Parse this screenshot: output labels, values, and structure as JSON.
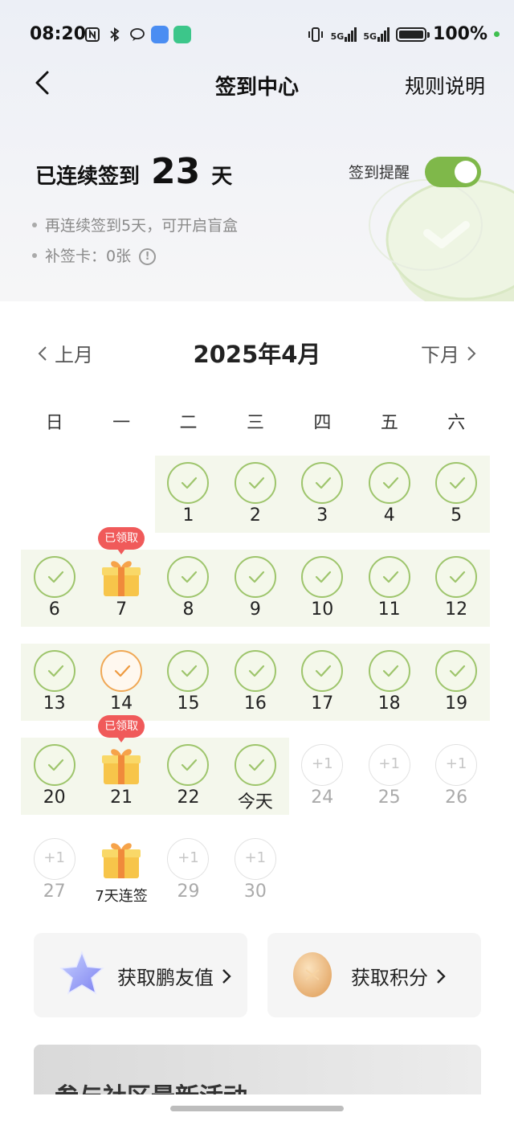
{
  "status_bar": {
    "time": "08:20",
    "battery": "100%",
    "network1": "5G",
    "network2": "5G"
  },
  "nav": {
    "title": "签到中心",
    "rules": "规则说明"
  },
  "streak": {
    "prefix": "已连续签到",
    "days": "23",
    "suffix": "天"
  },
  "reminder": {
    "label": "签到提醒",
    "enabled": true
  },
  "info": {
    "line1": "再连续签到5天，可开启盲盒",
    "line2": "补签卡：0张"
  },
  "calendar": {
    "prev": "上月",
    "title": "2025年4月",
    "next": "下月",
    "weekdays": [
      "日",
      "一",
      "二",
      "三",
      "四",
      "五",
      "六"
    ],
    "days": [
      {
        "label": "1",
        "state": "done"
      },
      {
        "label": "2",
        "state": "done"
      },
      {
        "label": "3",
        "state": "done"
      },
      {
        "label": "4",
        "state": "done"
      },
      {
        "label": "5",
        "state": "done"
      },
      {
        "label": "6",
        "state": "done"
      },
      {
        "label": "7",
        "state": "gift",
        "tag": "已领取"
      },
      {
        "label": "8",
        "state": "done"
      },
      {
        "label": "9",
        "state": "done"
      },
      {
        "label": "10",
        "state": "done"
      },
      {
        "label": "11",
        "state": "done"
      },
      {
        "label": "12",
        "state": "done"
      },
      {
        "label": "13",
        "state": "done"
      },
      {
        "label": "14",
        "state": "makeup"
      },
      {
        "label": "15",
        "state": "done"
      },
      {
        "label": "16",
        "state": "done"
      },
      {
        "label": "17",
        "state": "done"
      },
      {
        "label": "18",
        "state": "done"
      },
      {
        "label": "19",
        "state": "done"
      },
      {
        "label": "20",
        "state": "done"
      },
      {
        "label": "21",
        "state": "gift",
        "tag": "已领取"
      },
      {
        "label": "22",
        "state": "done"
      },
      {
        "label": "今天",
        "state": "done"
      },
      {
        "label": "24",
        "state": "future",
        "bonus": "+1"
      },
      {
        "label": "25",
        "state": "future",
        "bonus": "+1"
      },
      {
        "label": "26",
        "state": "future",
        "bonus": "+1"
      },
      {
        "label": "27",
        "state": "future",
        "bonus": "+1"
      },
      {
        "label": "7天连签",
        "state": "gift-future"
      },
      {
        "label": "29",
        "state": "future",
        "bonus": "+1"
      },
      {
        "label": "30",
        "state": "future",
        "bonus": "+1"
      }
    ]
  },
  "cards": {
    "friend_value": "获取鹏友值",
    "points": "获取积分"
  },
  "banner": {
    "title": "参与社区最新活动"
  },
  "colors": {
    "accent_green": "#7fb84a",
    "check_green": "#9ec56c",
    "makeup_orange": "#f0a856",
    "tag_red": "#f05a5a"
  }
}
